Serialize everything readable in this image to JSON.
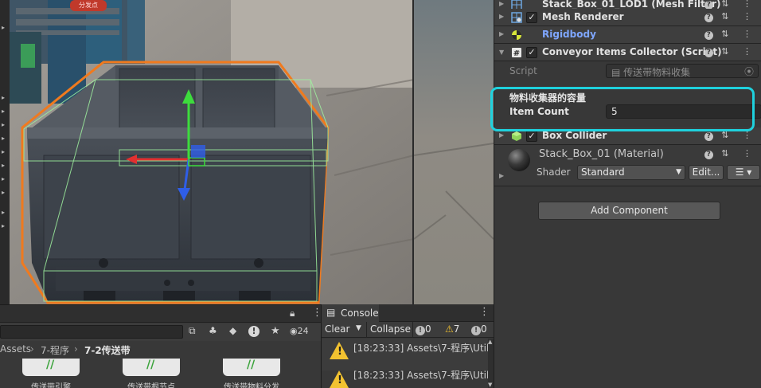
{
  "scene": {
    "badge": "分发点"
  },
  "inspector": {
    "components": [
      {
        "name": "Stack_Box_01_LOD1 (Mesh Filter)",
        "icon": "mesh-filter-icon",
        "checkbox": false
      },
      {
        "name": "Mesh Renderer",
        "icon": "mesh-renderer-icon",
        "checkbox": true
      },
      {
        "name": "Rigidbody",
        "icon": "rigidbody-icon",
        "checkbox": false,
        "color": "#7fa7ff"
      },
      {
        "name": "Conveyor Items Collector (Script)",
        "icon": "script-icon",
        "checkbox": true
      },
      {
        "name": "Box Collider",
        "icon": "box-collider-icon",
        "checkbox": true
      }
    ],
    "script_field": {
      "label": "Script",
      "value": "传送带物料收集"
    },
    "header": "物料收集器的容量",
    "item_count": {
      "label": "Item Count",
      "value": "5"
    },
    "material": {
      "name": "Stack_Box_01 (Material)",
      "shader_label": "Shader",
      "shader_value": "Standard",
      "edit_label": "Edit..."
    },
    "add_component_label": "Add Component",
    "highlight_color": "#1fd1dd"
  },
  "project": {
    "hidden_count": "24",
    "breadcrumb": [
      "Assets",
      "7-程序",
      "7-2传送带"
    ],
    "assets": [
      "传送带引擎",
      "传送带根节点",
      "传送带物料分发"
    ]
  },
  "console": {
    "tab_label": "Console",
    "clear_label": "Clear",
    "collapse_label": "Collapse",
    "info_count": "0",
    "warn_count": "7",
    "error_count": "0",
    "entries": [
      "[18:23:33] Assets\\7-程序\\Util",
      "[18:23:33] Assets\\7-程序\\Util"
    ]
  }
}
